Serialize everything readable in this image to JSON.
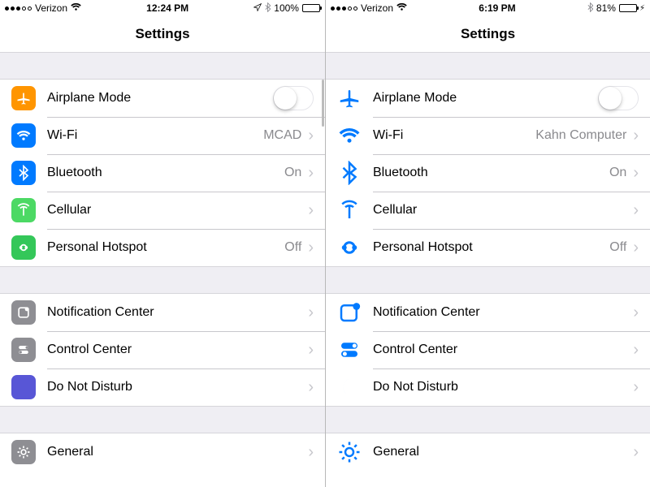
{
  "left": {
    "status": {
      "carrier": "Verizon",
      "time": "12:24 PM",
      "battery_pct": "100%",
      "battery_level": 100,
      "charging": false,
      "location_arrow": true,
      "signal_filled": 3
    },
    "title": "Settings",
    "sections": [
      [
        {
          "key": "airplane",
          "label": "Airplane Mode",
          "toggle": false
        },
        {
          "key": "wifi",
          "label": "Wi-Fi",
          "value": "MCAD",
          "chevron": true
        },
        {
          "key": "bluetooth",
          "label": "Bluetooth",
          "value": "On",
          "chevron": true
        },
        {
          "key": "cellular",
          "label": "Cellular",
          "chevron": true
        },
        {
          "key": "hotspot",
          "label": "Personal Hotspot",
          "value": "Off",
          "chevron": true
        }
      ],
      [
        {
          "key": "notif",
          "label": "Notification Center",
          "chevron": true
        },
        {
          "key": "control",
          "label": "Control Center",
          "chevron": true
        },
        {
          "key": "dnd",
          "label": "Do Not Disturb",
          "chevron": true
        }
      ],
      [
        {
          "key": "general",
          "label": "General",
          "chevron": true
        }
      ]
    ]
  },
  "right": {
    "status": {
      "carrier": "Verizon",
      "time": "6:19 PM",
      "battery_pct": "81%",
      "battery_level": 81,
      "charging": true,
      "location_arrow": false,
      "signal_filled": 3
    },
    "title": "Settings",
    "sections": [
      [
        {
          "key": "airplane",
          "label": "Airplane Mode",
          "toggle": false
        },
        {
          "key": "wifi",
          "label": "Wi-Fi",
          "value": "Kahn Computer",
          "chevron": true
        },
        {
          "key": "bluetooth",
          "label": "Bluetooth",
          "value": "On",
          "chevron": true
        },
        {
          "key": "cellular",
          "label": "Cellular",
          "chevron": true
        },
        {
          "key": "hotspot",
          "label": "Personal Hotspot",
          "value": "Off",
          "chevron": true
        }
      ],
      [
        {
          "key": "notif",
          "label": "Notification Center",
          "chevron": true
        },
        {
          "key": "control",
          "label": "Control Center",
          "chevron": true
        },
        {
          "key": "dnd",
          "label": "Do Not Disturb",
          "chevron": true
        }
      ],
      [
        {
          "key": "general",
          "label": "General",
          "chevron": true
        }
      ]
    ]
  }
}
